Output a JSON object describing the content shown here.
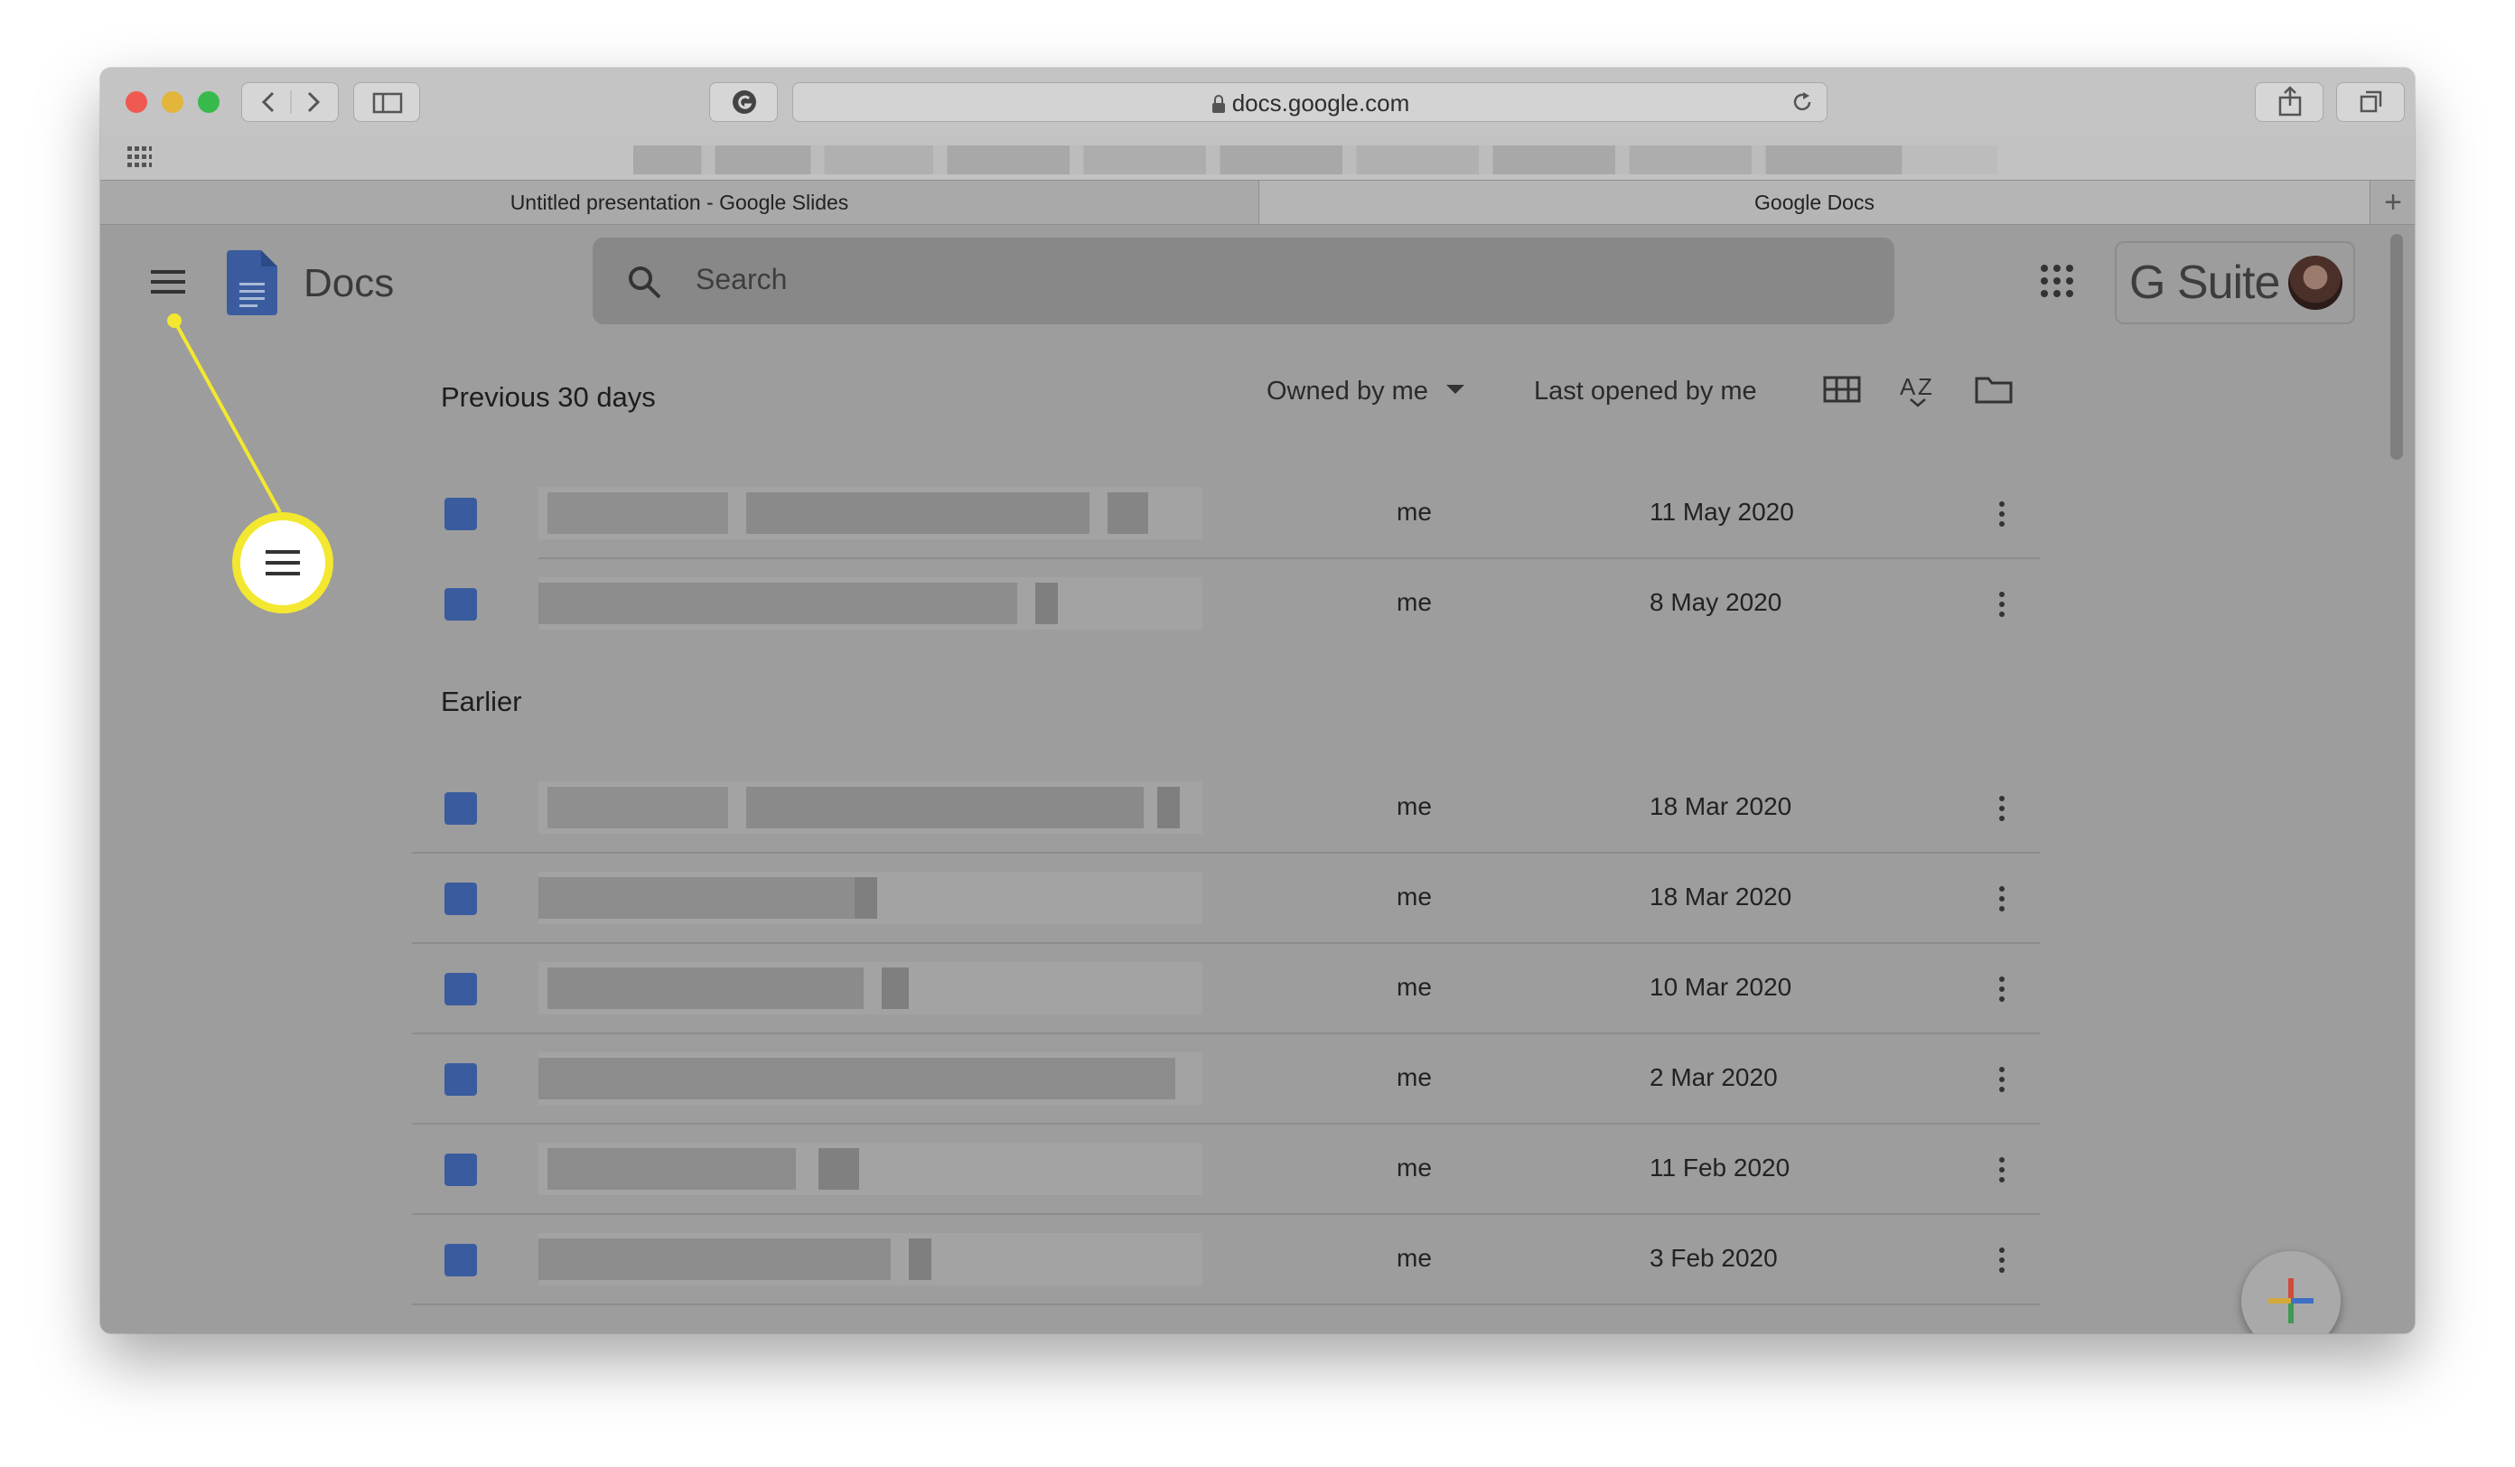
{
  "browser": {
    "url": "docs.google.com",
    "tabs": [
      {
        "label": "Untitled presentation - Google Slides"
      },
      {
        "label": "Google Docs"
      }
    ],
    "new_tab_label": "+"
  },
  "app": {
    "name": "Docs",
    "search_placeholder": "Search",
    "gsuite_label": "G Suite"
  },
  "filters": {
    "owner": "Owned by me",
    "sort": "Last opened by me"
  },
  "sections": [
    {
      "title": "Previous 30 days",
      "rows": [
        {
          "owner": "me",
          "date": "11 May 2020"
        },
        {
          "owner": "me",
          "date": "8 May 2020"
        }
      ]
    },
    {
      "title": "Earlier",
      "rows": [
        {
          "owner": "me",
          "date": "18 Mar 2020"
        },
        {
          "owner": "me",
          "date": "18 Mar 2020"
        },
        {
          "owner": "me",
          "date": "10 Mar 2020"
        },
        {
          "owner": "me",
          "date": "2 Mar 2020"
        },
        {
          "owner": "me",
          "date": "11 Feb 2020"
        },
        {
          "owner": "me",
          "date": "3 Feb 2020"
        }
      ]
    }
  ],
  "colors": {
    "docs_blue": "#4a7bd8",
    "highlight_yellow": "#f3e82f",
    "close": "#ee5a52",
    "minimize": "#e3b53a",
    "zoom": "#38b94c"
  },
  "icons": [
    "hamburger-menu-icon",
    "docs-logo-icon",
    "search-icon",
    "apps-grid-icon",
    "grid-view-icon",
    "sort-az-icon",
    "folder-icon",
    "more-vert-icon",
    "plus-icon"
  ]
}
